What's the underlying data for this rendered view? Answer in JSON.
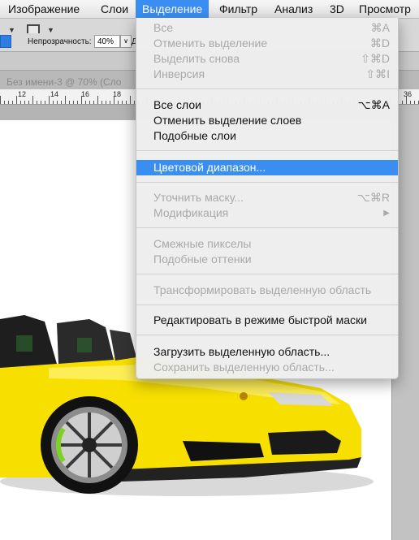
{
  "menubar": {
    "items": [
      {
        "label": "Изображение"
      },
      {
        "label": "Слои"
      },
      {
        "label": "Выделение"
      },
      {
        "label": "Фильтр"
      },
      {
        "label": "Анализ"
      },
      {
        "label": "3D"
      },
      {
        "label": "Просмотр"
      }
    ]
  },
  "options": {
    "opacity_label": "Непрозрачность:",
    "opacity_value": "40%",
    "trailing_label": "Д"
  },
  "document": {
    "tab_title": "Без имени-3 @ 70% (Сло"
  },
  "ruler": {
    "labels": [
      "12",
      "14",
      "16",
      "18",
      "36"
    ]
  },
  "menu": {
    "items": [
      {
        "label": "Все",
        "shortcut": "⌘A",
        "enabled": false
      },
      {
        "label": "Отменить выделение",
        "shortcut": "⌘D",
        "enabled": false
      },
      {
        "label": "Выделить снова",
        "shortcut": "⇧⌘D",
        "enabled": false
      },
      {
        "label": "Инверсия",
        "shortcut": "⇧⌘I",
        "enabled": false
      },
      {
        "label": "Все слои",
        "shortcut": "⌥⌘A",
        "enabled": true
      },
      {
        "label": "Отменить выделение слоев",
        "shortcut": "",
        "enabled": true
      },
      {
        "label": "Подобные слои",
        "shortcut": "",
        "enabled": true
      },
      {
        "label": "Цветовой диапазон...",
        "shortcut": "",
        "enabled": true,
        "highlighted": true
      },
      {
        "label": "Уточнить маску...",
        "shortcut": "⌥⌘R",
        "enabled": false
      },
      {
        "label": "Модификация",
        "shortcut": "▶",
        "enabled": false
      },
      {
        "label": "Смежные пикселы",
        "shortcut": "",
        "enabled": false
      },
      {
        "label": "Подобные оттенки",
        "shortcut": "",
        "enabled": false
      },
      {
        "label": "Трансформировать выделенную область",
        "shortcut": "",
        "enabled": false
      },
      {
        "label": "Редактировать в режиме быстрой маски",
        "shortcut": "",
        "enabled": true
      },
      {
        "label": "Загрузить выделенную область...",
        "shortcut": "",
        "enabled": true
      },
      {
        "label": "Сохранить выделенную область...",
        "shortcut": "",
        "enabled": false
      }
    ]
  },
  "colors": {
    "accent": "#3b8ef1",
    "car_body": "#f7e000"
  }
}
